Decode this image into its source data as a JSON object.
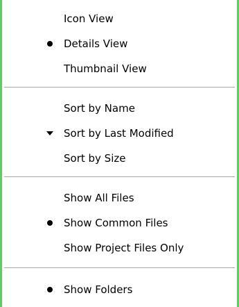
{
  "menu": {
    "sections": [
      {
        "items": [
          {
            "label": "Icon View",
            "mark": "none"
          },
          {
            "label": "Details View",
            "mark": "bullet"
          },
          {
            "label": "Thumbnail View",
            "mark": "none"
          }
        ]
      },
      {
        "items": [
          {
            "label": "Sort by Name",
            "mark": "none"
          },
          {
            "label": "Sort by Last Modified",
            "mark": "descending-arrow"
          },
          {
            "label": "Sort by Size",
            "mark": "none"
          }
        ]
      },
      {
        "items": [
          {
            "label": "Show All Files",
            "mark": "none"
          },
          {
            "label": "Show Common Files",
            "mark": "bullet"
          },
          {
            "label": "Show Project Files Only",
            "mark": "none"
          }
        ]
      },
      {
        "items": [
          {
            "label": "Show Folders",
            "mark": "bullet"
          }
        ]
      }
    ]
  },
  "colors": {
    "frame_border": "#5fce5f",
    "separator": "#a7a6aa",
    "text": "#000000"
  }
}
